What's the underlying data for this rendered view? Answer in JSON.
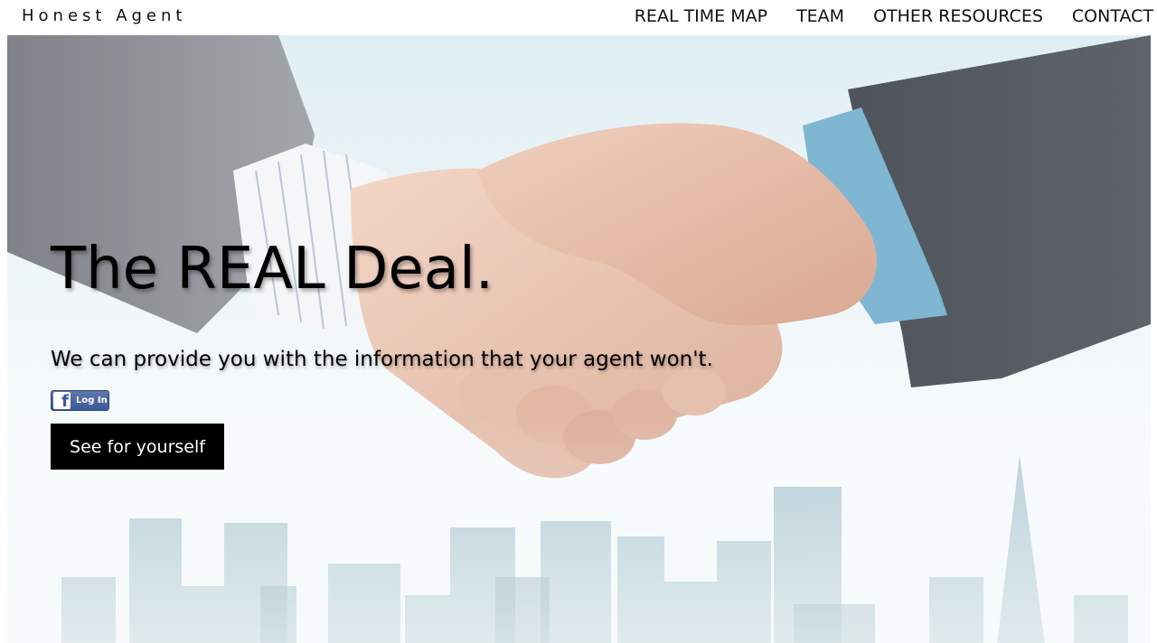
{
  "header": {
    "brand": "Honest Agent",
    "nav": [
      {
        "label": "REAL TIME MAP"
      },
      {
        "label": "TEAM"
      },
      {
        "label": "OTHER RESOURCES"
      },
      {
        "label": "CONTACT"
      }
    ]
  },
  "hero": {
    "headline": "The REAL Deal.",
    "subheadline": "We can provide you with the information that your agent won't.",
    "facebook_login": {
      "icon": "facebook-icon",
      "label": "Log In"
    },
    "cta_label": "See for yourself"
  },
  "colors": {
    "cta_background": "#000000",
    "facebook_blue": "#3b5998",
    "sky": "#e7f2f5",
    "skyline": "#9fbfcb"
  }
}
